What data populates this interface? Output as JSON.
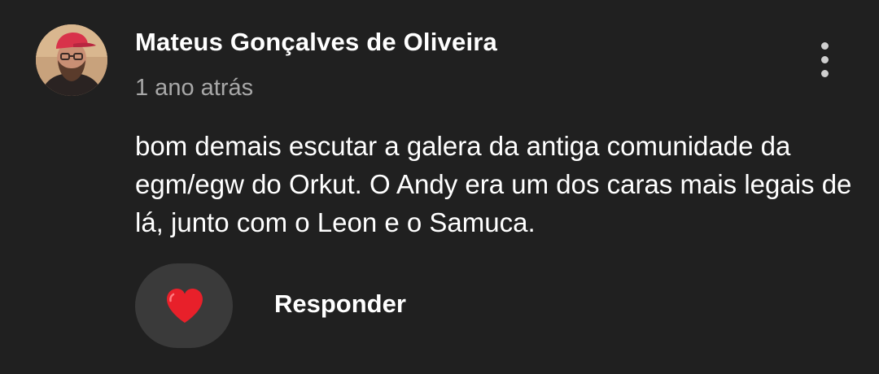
{
  "comment": {
    "author": "Mateus Gonçalves de Oliveira",
    "timestamp": "1 ano atrás",
    "text": "bom demais escutar a galera da antiga comunidade da egm/egw do Orkut. O Andy era um dos caras mais legais de lá, junto com o Leon e o Samuca.",
    "avatar_icon": "user-avatar-photo",
    "menu_icon": "more-vertical-icon"
  },
  "actions": {
    "like_icon": "heart-icon",
    "like_color": "#e8202a",
    "reply_label": "Responder"
  },
  "colors": {
    "background": "#202020",
    "secondary_text": "#a8a8a8",
    "like_button_bg": "#3a3a3a"
  }
}
